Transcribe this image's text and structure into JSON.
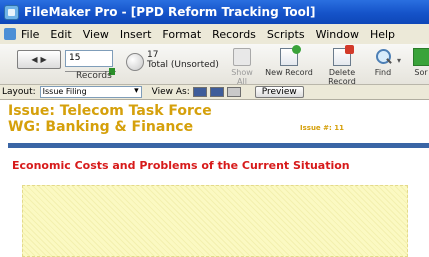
{
  "window": {
    "title": "FileMaker Pro - [PPD Reform Tracking Tool]"
  },
  "menu": {
    "items": [
      "File",
      "Edit",
      "View",
      "Insert",
      "Format",
      "Records",
      "Scripts",
      "Window",
      "Help"
    ]
  },
  "toolbar": {
    "record_number": "15",
    "records_label": "Records",
    "record_count": "17",
    "record_count_status": "Total (Unsorted)",
    "show_all": "Show All",
    "new_record": "New Record",
    "delete_record": "Delete Record",
    "find": "Find",
    "sort": "Sor"
  },
  "layoutbar": {
    "layout_label": "Layout:",
    "layout_value": "Issue Filing",
    "view_as_label": "View As:",
    "preview": "Preview"
  },
  "record": {
    "issue_line": "Issue: Telecom Task Force",
    "wg_line": "WG: Banking & Finance",
    "issue_number_label": "Issue #: 11",
    "section_heading": "Economic Costs and Problems of the Current Situation"
  },
  "colors": {
    "accent_gold": "#d5a00b",
    "heading_red": "#d71a1a",
    "rule_blue": "#3a65a5",
    "field_yellow": "#fbf9c2"
  }
}
